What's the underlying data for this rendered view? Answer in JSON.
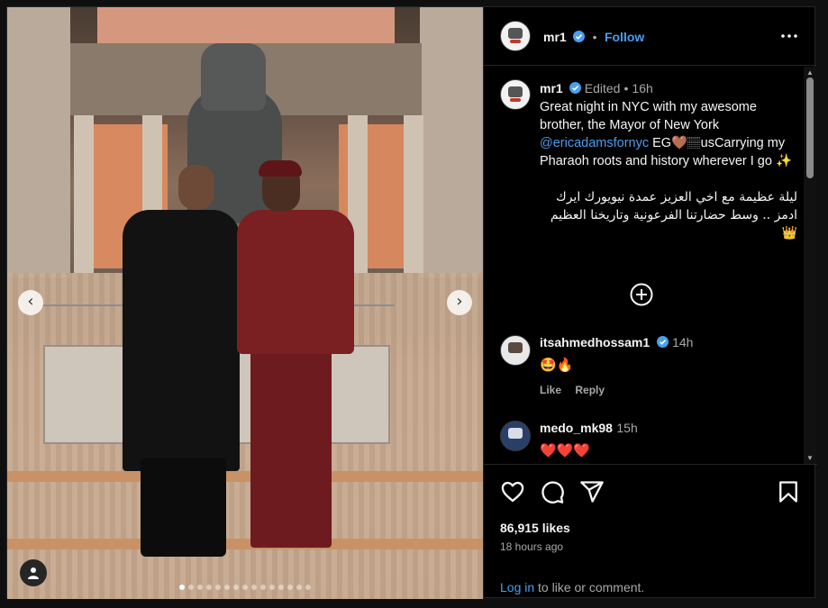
{
  "header": {
    "username": "mr1",
    "separator": "•",
    "follow_label": "Follow",
    "more_icon": "more-horizontal-icon"
  },
  "caption": {
    "username": "mr1",
    "edited": "Edited",
    "dot": "•",
    "time": "16h",
    "text_before_mention": "Great night in NYC with my awesome brother, the Mayor of New York",
    "mention": "@ericadamsfornyc",
    "text_after_mention": " EG🤎🏽usCarrying my Pharaoh roots and history wherever I go ✨",
    "arabic_text": "ليلة عظيمة مع اخي العزيز عمدة نيويورك ايرك ادمز .. وسط حضارتنا الفرعونية وتاريخنا العظيم 👑"
  },
  "comments": [
    {
      "username": "itsahmedhossam1",
      "verified": true,
      "time": "14h",
      "text": "🤩🔥",
      "like_label": "Like",
      "reply_label": "Reply"
    },
    {
      "username": "medo_mk98",
      "verified": false,
      "time": "15h",
      "text": "❤️❤️❤️"
    }
  ],
  "actions": {
    "likes": "86,915 likes",
    "time_ago": "18 hours ago",
    "login_link": "Log in",
    "login_rest": " to like or comment."
  },
  "carousel": {
    "slide_count": 15,
    "active_index": 0
  },
  "colors": {
    "accent": "#4a9eed",
    "background": "#000000",
    "text": "#f5f5f5",
    "muted": "#a8a8a8",
    "heart": "#ed4956"
  },
  "icons": [
    "heart-icon",
    "comment-icon",
    "share-icon",
    "bookmark-icon",
    "add-circle-icon",
    "user-tag-icon",
    "verified-icon"
  ]
}
